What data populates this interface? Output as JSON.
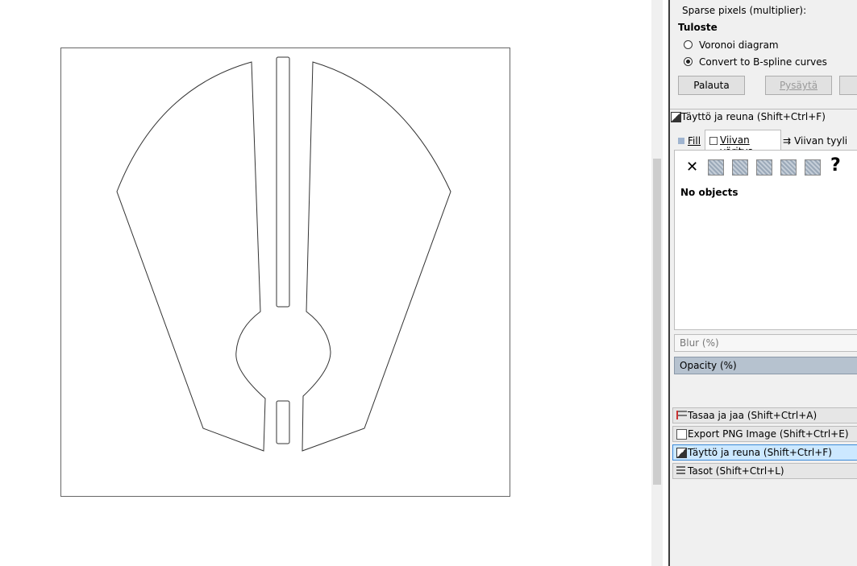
{
  "panel": {
    "sparse_pixels_label": "Sparse pixels (multiplier):",
    "output_heading": "Tuloste",
    "output_options": [
      {
        "label": "Voronoi diagram",
        "selected": false
      },
      {
        "label": "Convert to B-spline curves",
        "selected": true
      }
    ],
    "reset_button": "Palauta",
    "stop_button": "Pysäytä"
  },
  "fill_stroke": {
    "title": "Täyttö ja reuna (Shift+Ctrl+F)",
    "tabs": [
      "Fill",
      "Viivan väritys",
      "Viivan tyyli"
    ],
    "unset_glyph": "✕",
    "unknown_glyph": "?",
    "status": "No objects",
    "blur_label": "Blur (%)",
    "opacity_label": "Opacity (%)"
  },
  "docked": [
    {
      "label": "Tasaa ja jaa (Shift+Ctrl+A)",
      "icon": "align-icon",
      "active": false
    },
    {
      "label": "Export PNG Image (Shift+Ctrl+E)",
      "icon": "export-icon",
      "active": false
    },
    {
      "label": "Täyttö ja reuna (Shift+Ctrl+F)",
      "icon": "fill-stroke-icon",
      "active": true
    },
    {
      "label": "Tasot (Shift+Ctrl+L)",
      "icon": "layers-icon",
      "active": false
    }
  ]
}
